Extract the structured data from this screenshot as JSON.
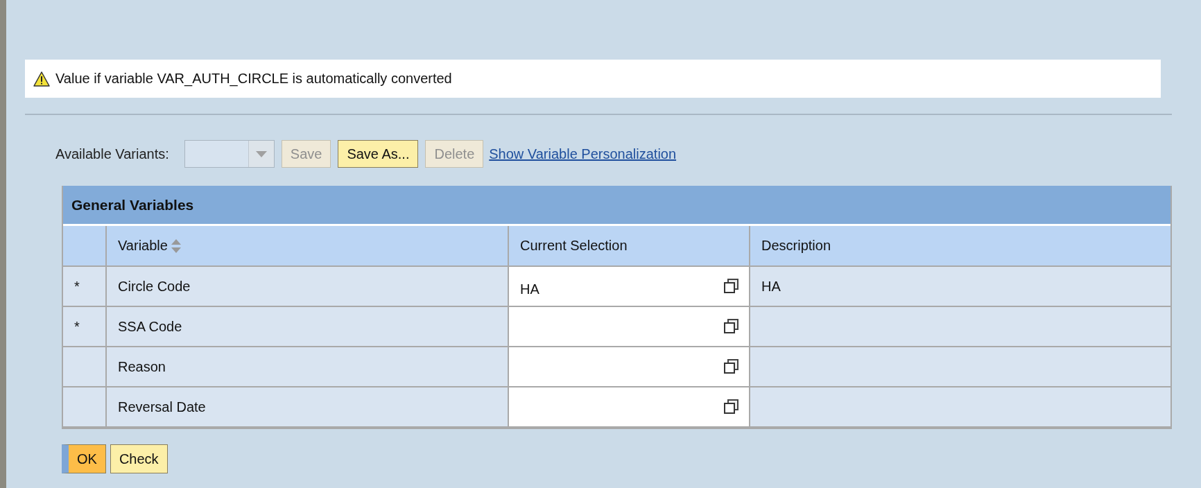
{
  "message": {
    "text": "Value if variable VAR_AUTH_CIRCLE is automatically converted"
  },
  "toolbar": {
    "label": "Available Variants:",
    "variant_select": {
      "disabled": true
    },
    "buttons": [
      {
        "label": "Save",
        "disabled": true
      },
      {
        "label": "Save As...",
        "disabled": false
      },
      {
        "label": "Delete",
        "disabled": true
      }
    ],
    "link": "Show Variable Personalization"
  },
  "table": {
    "title": "General Variables",
    "columns": [
      "Variable",
      "Current Selection",
      "Description"
    ],
    "rows": [
      {
        "marker": "*",
        "variable": "Circle Code",
        "value": "HA",
        "description": "HA"
      },
      {
        "marker": "*",
        "variable": "SSA Code"
      },
      {
        "variable": "Reason"
      },
      {
        "variable": "Reversal Date"
      }
    ]
  },
  "footer_buttons": [
    {
      "label": "OK",
      "emphasized": true
    },
    {
      "label": "Check",
      "emphasized": false
    }
  ]
}
